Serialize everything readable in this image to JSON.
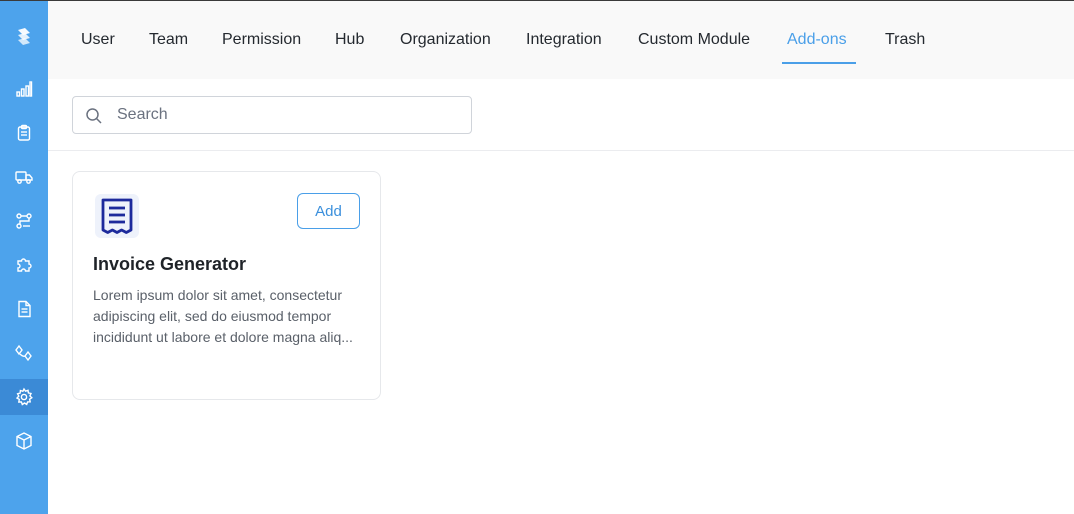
{
  "sidebar": {
    "logo_icon": "brand-logo-icon",
    "items": [
      {
        "icon": "bar-chart-icon",
        "active": false
      },
      {
        "icon": "clipboard-icon",
        "active": false
      },
      {
        "icon": "truck-icon",
        "active": false
      },
      {
        "icon": "workflow-icon",
        "active": false
      },
      {
        "icon": "puzzle-icon",
        "active": false
      },
      {
        "icon": "document-icon",
        "active": false
      },
      {
        "icon": "route-icon",
        "active": false
      },
      {
        "icon": "gear-icon",
        "active": true
      },
      {
        "icon": "cube-icon",
        "active": false
      }
    ],
    "bg_color": "#4da3ec",
    "active_color": "#3b8ad6"
  },
  "tabs": [
    {
      "label": "User"
    },
    {
      "label": "Team"
    },
    {
      "label": "Permission"
    },
    {
      "label": "Hub"
    },
    {
      "label": "Organization"
    },
    {
      "label": "Integration"
    },
    {
      "label": "Custom Module"
    },
    {
      "label": "Add-ons",
      "active": true
    },
    {
      "label": "Trash"
    }
  ],
  "search": {
    "placeholder": "Search",
    "value": ""
  },
  "addons": [
    {
      "name": "Invoice Generator",
      "description": "Lorem ipsum dolor sit amet, consectetur adipiscing elit, sed do eiusmod tempor incididunt ut labore et dolore magna aliq...",
      "icon": "receipt-icon",
      "action_label": "Add"
    }
  ],
  "accent_color": "#4a9fe8"
}
